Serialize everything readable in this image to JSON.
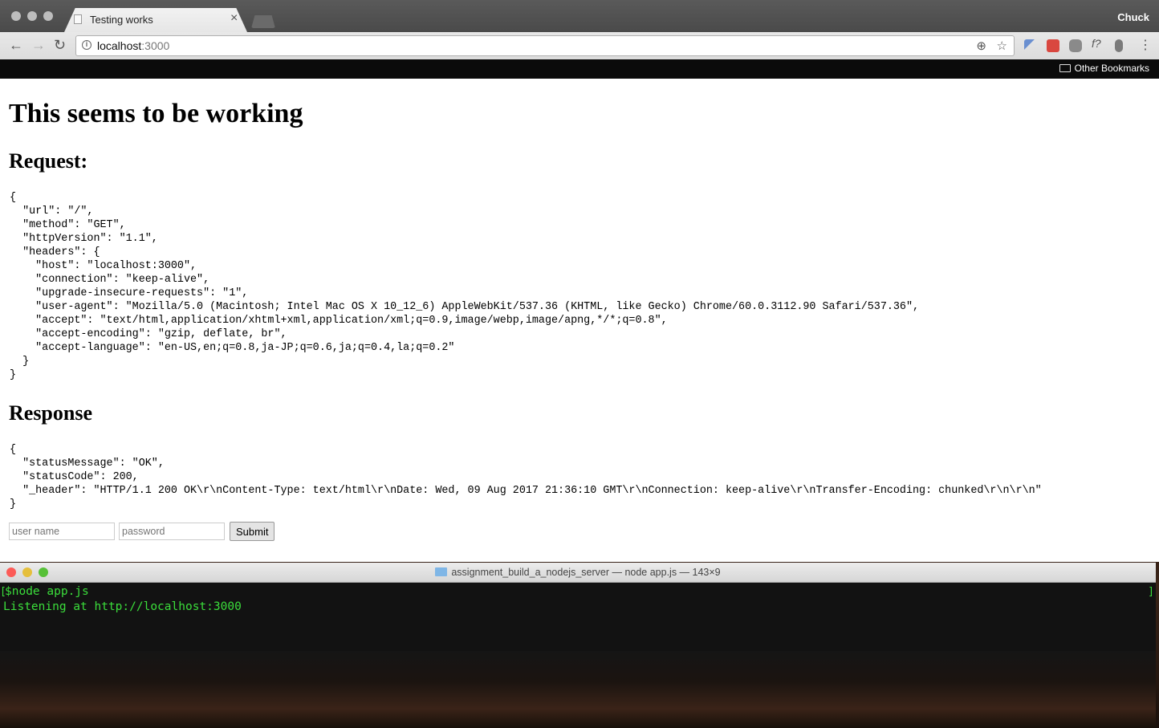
{
  "browser": {
    "tab_title": "Testing works",
    "profile_name": "Chuck",
    "url_host": "localhost",
    "url_port": ":3000",
    "bookmark_folder": "Other Bookmarks"
  },
  "page": {
    "title": "This seems to be working",
    "request_heading": "Request:",
    "request_json": "{\n  \"url\": \"/\",\n  \"method\": \"GET\",\n  \"httpVersion\": \"1.1\",\n  \"headers\": {\n    \"host\": \"localhost:3000\",\n    \"connection\": \"keep-alive\",\n    \"upgrade-insecure-requests\": \"1\",\n    \"user-agent\": \"Mozilla/5.0 (Macintosh; Intel Mac OS X 10_12_6) AppleWebKit/537.36 (KHTML, like Gecko) Chrome/60.0.3112.90 Safari/537.36\",\n    \"accept\": \"text/html,application/xhtml+xml,application/xml;q=0.9,image/webp,image/apng,*/*;q=0.8\",\n    \"accept-encoding\": \"gzip, deflate, br\",\n    \"accept-language\": \"en-US,en;q=0.8,ja-JP;q=0.6,ja;q=0.4,la;q=0.2\"\n  }\n}",
    "response_heading": "Response",
    "response_json": "{\n  \"statusMessage\": \"OK\",\n  \"statusCode\": 200,\n  \"_header\": \"HTTP/1.1 200 OK\\r\\nContent-Type: text/html\\r\\nDate: Wed, 09 Aug 2017 21:36:10 GMT\\r\\nConnection: keep-alive\\r\\nTransfer-Encoding: chunked\\r\\n\\r\\n\"\n}",
    "form": {
      "username_placeholder": "user name",
      "password_placeholder": "password",
      "submit_label": "Submit"
    }
  },
  "terminal": {
    "title": "assignment_build_a_nodejs_server — node app.js — 143×9",
    "line1_bracket": "[",
    "line1": "$node app.js",
    "line2": "Listening at http://localhost:3000",
    "right_bracket": "]"
  },
  "colors": {
    "terminal_text": "#3bde3b",
    "close_red": "#fc5b57",
    "minimize_yellow": "#e5bf3c",
    "zoom_green": "#57c038"
  },
  "icons": [
    "file-icon",
    "close-icon",
    "back-arrow-icon",
    "forward-arrow-icon",
    "reload-icon",
    "info-icon",
    "zoom-icon",
    "star-icon",
    "folder-icon"
  ]
}
